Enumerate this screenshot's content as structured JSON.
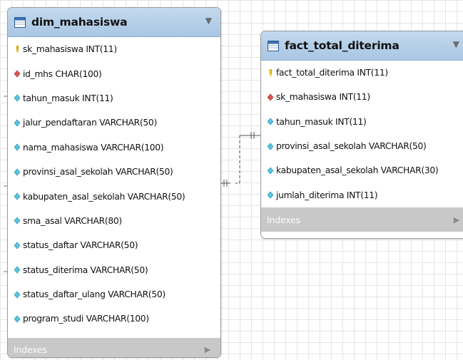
{
  "tables": [
    {
      "name": "dim_mahasiswa",
      "columns": [
        {
          "text": "sk_mahasiswa INT(11)",
          "key": "primary"
        },
        {
          "text": "id_mhs CHAR(100)",
          "key": "nonnull"
        },
        {
          "text": "tahun_masuk INT(11)",
          "key": "nullable"
        },
        {
          "text": "jalur_pendaftaran VARCHAR(50)",
          "key": "nullable"
        },
        {
          "text": "nama_mahasiswa VARCHAR(100)",
          "key": "nullable"
        },
        {
          "text": "provinsi_asal_sekolah VARCHAR(50)",
          "key": "nullable"
        },
        {
          "text": "kabupaten_asal_sekolah VARCHAR(50)",
          "key": "nullable"
        },
        {
          "text": "sma_asal VARCHAR(80)",
          "key": "nullable"
        },
        {
          "text": "status_daftar VARCHAR(50)",
          "key": "nullable"
        },
        {
          "text": "status_diterima VARCHAR(50)",
          "key": "nullable"
        },
        {
          "text": "status_daftar_ulang VARCHAR(50)",
          "key": "nullable"
        },
        {
          "text": "program_studi VARCHAR(100)",
          "key": "nullable"
        }
      ],
      "indexes_label": "Indexes"
    },
    {
      "name": "fact_total_diterima",
      "columns": [
        {
          "text": "fact_total_diterima INT(11)",
          "key": "primary"
        },
        {
          "text": "sk_mahasiswa INT(11)",
          "key": "nonnull"
        },
        {
          "text": "tahun_masuk INT(11)",
          "key": "nullable"
        },
        {
          "text": "provinsi_asal_sekolah VARCHAR(50)",
          "key": "nullable"
        },
        {
          "text": "kabupaten_asal_sekolah VARCHAR(30)",
          "key": "nullable"
        },
        {
          "text": "jumlah_diterima INT(11)",
          "key": "nullable"
        }
      ],
      "indexes_label": "Indexes"
    }
  ],
  "colors": {
    "header": "#b3cde8",
    "primary_key": "#f2c300",
    "nonnull": "#d9534f",
    "nullable": "#58c4e0",
    "indexes_bar": "#c8c8c8"
  }
}
